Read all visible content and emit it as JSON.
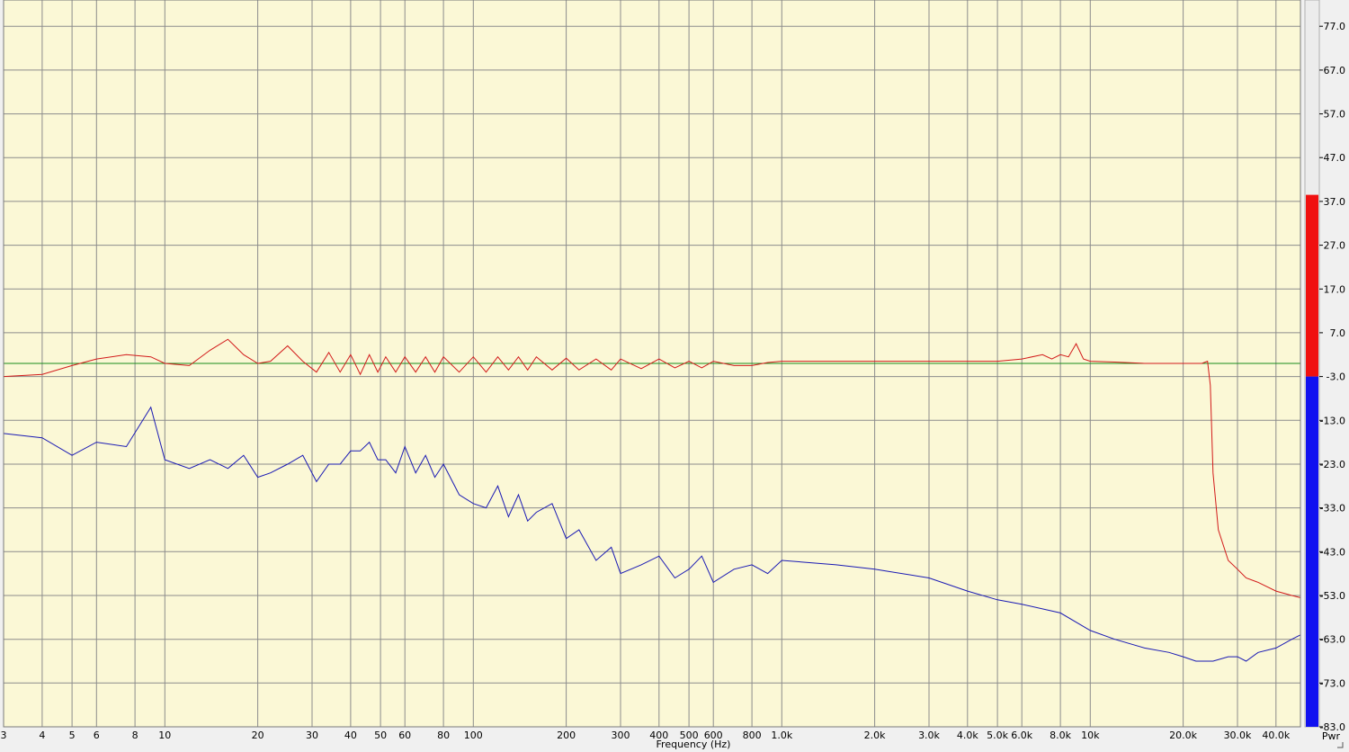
{
  "colors": {
    "plot_bg": "#fbf8d6",
    "grid": "#8c8c8c",
    "red_trace": "#d21a1a",
    "blue_trace": "#1a1ab4",
    "green_ref": "#1a8c1a",
    "meter_red": "#f01010",
    "meter_blue": "#1010f0",
    "window_bg": "#f0f0f0"
  },
  "chart_data": {
    "type": "line",
    "xlabel": "Frequency (Hz)",
    "x_scale": "log",
    "xlim": [
      3,
      48000
    ],
    "ylim": [
      -83,
      83
    ],
    "ylabel": "",
    "grid": true,
    "x_tick_values": [
      3,
      4,
      5,
      6,
      8,
      10,
      20,
      30,
      40,
      50,
      60,
      80,
      100,
      200,
      300,
      400,
      500,
      600,
      800,
      1000,
      2000,
      3000,
      4000,
      5000,
      6000,
      8000,
      10000,
      20000,
      30000,
      40000
    ],
    "x_tick_labels": [
      "3",
      "4",
      "5",
      "6",
      "8",
      "10",
      "20",
      "30",
      "40",
      "50",
      "60",
      "80",
      "100",
      "200",
      "300",
      "400",
      "500",
      "600",
      "800",
      "1.0k",
      "2.0k",
      "3.0k",
      "4.0k",
      "5.0k",
      "6.0k",
      "8.0k",
      "10k",
      "20.0k",
      "30.0k",
      "40.0k"
    ],
    "y_tick_values": [
      77,
      67,
      57,
      47,
      37,
      27,
      17,
      7,
      -3,
      -13,
      -23,
      -33,
      -43,
      -53,
      -63,
      -73,
      -83
    ],
    "y_tick_labels": [
      "77.0",
      "67.0",
      "57.0",
      "47.0",
      "37.0",
      "27.0",
      "17.0",
      "7.0",
      "-3.0",
      "-13.0",
      "-23.0",
      "-33.0",
      "-43.0",
      "-53.0",
      "-63.0",
      "-73.0",
      "-83.0"
    ],
    "reference_level": 0,
    "meter": {
      "label": "Pwr",
      "top_value": 38.5,
      "split_value": -3
    },
    "series": [
      {
        "color": "red",
        "x": [
          3,
          4,
          5,
          6,
          7.5,
          9,
          10,
          12,
          14,
          16,
          18,
          20,
          22,
          25,
          28,
          31,
          34,
          37,
          40,
          43,
          46,
          49,
          52,
          56,
          60,
          65,
          70,
          75,
          80,
          90,
          100,
          110,
          120,
          130,
          140,
          150,
          160,
          180,
          200,
          220,
          250,
          280,
          300,
          350,
          400,
          450,
          500,
          550,
          600,
          700,
          800,
          900,
          1000,
          1500,
          2000,
          3000,
          4000,
          5000,
          6000,
          7000,
          7500,
          8000,
          8500,
          9000,
          9500,
          10000,
          12000,
          15000,
          20000,
          23000,
          24000,
          24500,
          25000,
          26000,
          28000,
          30000,
          32000,
          35000,
          40000,
          45000,
          48000
        ],
        "y": [
          -3,
          -2.5,
          -0.5,
          1,
          2,
          1.5,
          0,
          -0.5,
          3,
          5.5,
          2,
          0,
          0.5,
          4,
          0.5,
          -2,
          2.5,
          -2,
          2,
          -2.5,
          2,
          -2,
          1.5,
          -2,
          1.5,
          -2,
          1.5,
          -2,
          1.5,
          -2,
          1.5,
          -2,
          1.5,
          -1.5,
          1.5,
          -1.5,
          1.5,
          -1.5,
          1.2,
          -1.5,
          1,
          -1.5,
          1,
          -1.2,
          1,
          -1,
          0.5,
          -1,
          0.5,
          -0.5,
          -0.5,
          0.2,
          0.5,
          0.5,
          0.5,
          0.5,
          0.5,
          0.5,
          1,
          2,
          1,
          2,
          1.5,
          4.5,
          1,
          0.5,
          0.3,
          0,
          0,
          0,
          0.5,
          -5,
          -25,
          -38,
          -45,
          -47,
          -49,
          -50,
          -52,
          -53,
          -53.5
        ]
      },
      {
        "color": "blue",
        "x": [
          3,
          4,
          5,
          6,
          7.5,
          9,
          10,
          12,
          14,
          16,
          18,
          20,
          22,
          25,
          28,
          31,
          34,
          37,
          40,
          43,
          46,
          49,
          52,
          56,
          60,
          65,
          70,
          75,
          80,
          90,
          100,
          110,
          120,
          130,
          140,
          150,
          160,
          180,
          200,
          220,
          250,
          280,
          300,
          350,
          400,
          450,
          500,
          550,
          600,
          700,
          800,
          900,
          1000,
          1500,
          2000,
          3000,
          4000,
          5000,
          6000,
          8000,
          10000,
          12000,
          15000,
          18000,
          20000,
          22000,
          25000,
          28000,
          30000,
          32000,
          35000,
          40000,
          45000,
          48000
        ],
        "y": [
          -16,
          -17,
          -21,
          -18,
          -19,
          -10,
          -22,
          -24,
          -22,
          -24,
          -21,
          -26,
          -25,
          -23,
          -21,
          -27,
          -23,
          -23,
          -20,
          -20,
          -18,
          -22,
          -22,
          -25,
          -19,
          -25,
          -21,
          -26,
          -23,
          -30,
          -32,
          -33,
          -28,
          -35,
          -30,
          -36,
          -34,
          -32,
          -40,
          -38,
          -45,
          -42,
          -48,
          -46,
          -44,
          -49,
          -47,
          -44,
          -50,
          -47,
          -46,
          -48,
          -45,
          -46,
          -47,
          -49,
          -52,
          -54,
          -55,
          -57,
          -61,
          -63,
          -65,
          -66,
          -67,
          -68,
          -68,
          -67,
          -67,
          -68,
          -66,
          -65,
          -63,
          -62
        ]
      }
    ]
  }
}
